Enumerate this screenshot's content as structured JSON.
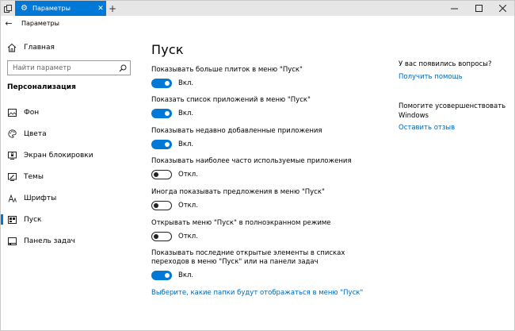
{
  "titlebar": {
    "tab_label": "Параметры",
    "close_glyph": "✕",
    "newtab_glyph": "+",
    "minimize_glyph": "—",
    "maximize_glyph": "☐",
    "close_window_glyph": "✕"
  },
  "app": {
    "back_glyph": "←",
    "title": "Параметры"
  },
  "sidebar": {
    "home_label": "Главная",
    "search_placeholder": "Найти параметр",
    "section_title": "Персонализация",
    "items": [
      {
        "label": "Фон",
        "icon": "image-icon"
      },
      {
        "label": "Цвета",
        "icon": "palette-icon"
      },
      {
        "label": "Экран блокировки",
        "icon": "lock-screen-icon"
      },
      {
        "label": "Темы",
        "icon": "brush-icon"
      },
      {
        "label": "Шрифты",
        "icon": "font-icon"
      },
      {
        "label": "Пуск",
        "icon": "start-icon",
        "active": true
      },
      {
        "label": "Панель задач",
        "icon": "taskbar-icon"
      }
    ]
  },
  "main": {
    "title": "Пуск",
    "settings": [
      {
        "label": "Показывать больше плиток в меню \"Пуск\"",
        "state": "on",
        "state_label": "Вкл."
      },
      {
        "label": "Показать список приложений в меню \"Пуск\"",
        "state": "on",
        "state_label": "Вкл."
      },
      {
        "label": "Показывать недавно добавленные приложения",
        "state": "on",
        "state_label": "Вкл."
      },
      {
        "label": "Показывать наиболее часто используемые приложения",
        "state": "off",
        "state_label": "Откл."
      },
      {
        "label": "Иногда показывать предложения в меню \"Пуск\"",
        "state": "off",
        "state_label": "Откл."
      },
      {
        "label": "Открывать меню \"Пуск\" в полноэкранном режиме",
        "state": "off",
        "state_label": "Откл."
      },
      {
        "label_line1": "Показывать последние открытые элементы в списках",
        "label_line2": "переходов в меню \"Пуск\" или на панели задач",
        "state": "on",
        "state_label": "Вкл."
      }
    ],
    "folders_link": "Выберите, какие папки будут отображаться в меню \"Пуск\""
  },
  "rightpanel": {
    "question": "У вас появились вопросы?",
    "help_link": "Получить помощь",
    "improve_line1": "Помогите усовершенствовать",
    "improve_line2": "Windows",
    "feedback_link": "Оставить отзыв"
  },
  "colors": {
    "accent": "#0078d7",
    "link": "#0067b8",
    "titlebar_bg": "#e6e6e6"
  }
}
